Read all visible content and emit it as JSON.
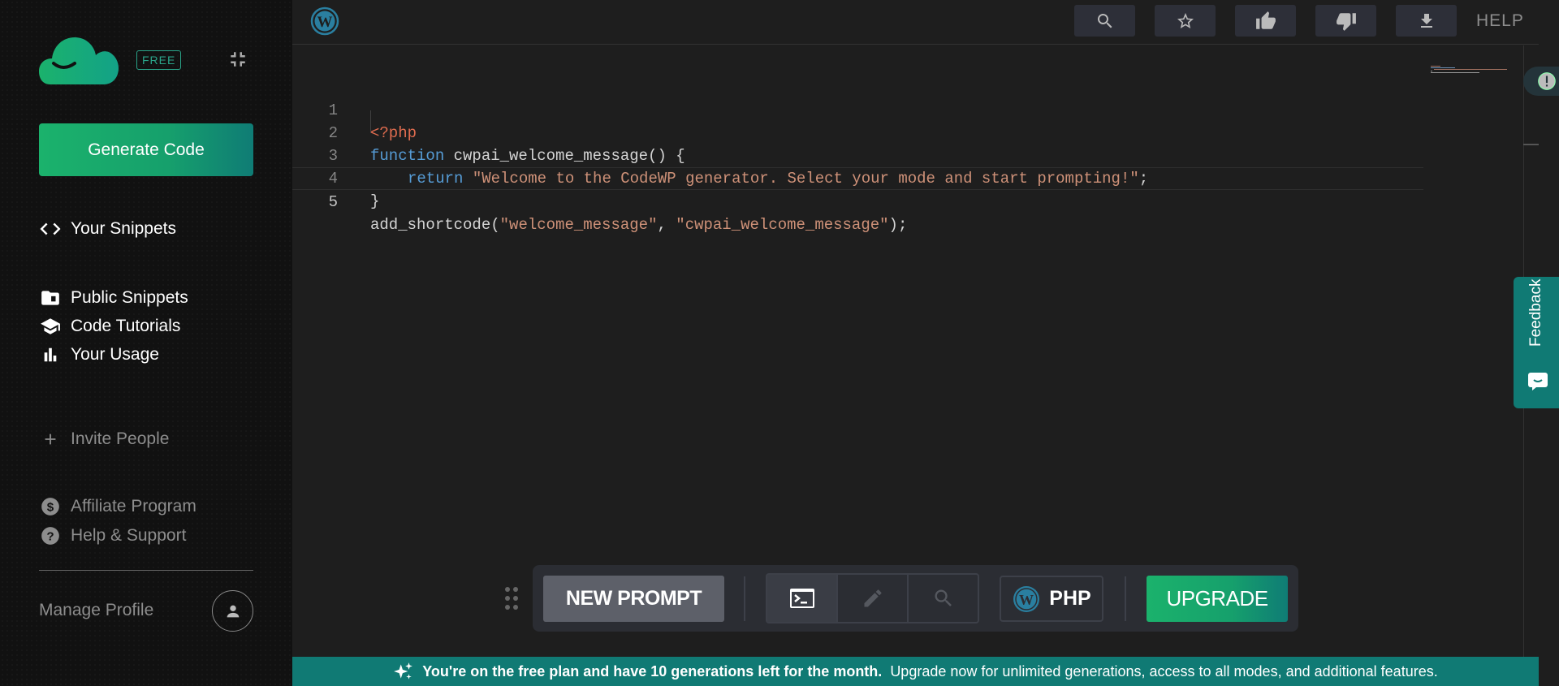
{
  "sidebar": {
    "badge": "FREE",
    "generate_label": "Generate Code",
    "items": [
      {
        "label": "Your Snippets",
        "icon": "code-icon"
      },
      {
        "label": "Public Snippets",
        "icon": "folder-icon"
      },
      {
        "label": "Code Tutorials",
        "icon": "graduation-cap-icon"
      },
      {
        "label": "Your Usage",
        "icon": "bar-chart-icon"
      },
      {
        "label": "Invite People",
        "icon": "plus-icon"
      },
      {
        "label": "Affiliate Program",
        "icon": "dollar-circle-icon"
      },
      {
        "label": "Help & Support",
        "icon": "help-circle-icon"
      }
    ],
    "manage_profile": "Manage Profile"
  },
  "topbar": {
    "buttons": [
      "search-icon",
      "star-icon",
      "thumbs-up-icon",
      "thumbs-down-icon",
      "download-icon"
    ],
    "help_label": "HELP"
  },
  "editor": {
    "line_numbers": [
      "1",
      "2",
      "3",
      "4",
      "5"
    ],
    "active_line": 5,
    "lines": {
      "l1": {
        "tag": "<?php"
      },
      "l2": {
        "kw": "function",
        "rest": " cwpai_welcome_message() {"
      },
      "l3": {
        "kw": "return",
        "str": "\"Welcome to the CodeWP generator. Select your mode and start prompting!\"",
        "end": ";"
      },
      "l4": {
        "text": "}"
      },
      "l5": {
        "fn": "add_shortcode(",
        "s1": "\"welcome_message\"",
        "comma": ", ",
        "s2": "\"cwpai_welcome_message\"",
        "end": ");"
      }
    }
  },
  "toolbar": {
    "new_prompt": "NEW PROMPT",
    "modes": [
      "terminal-icon",
      "pencil-icon",
      "search-icon"
    ],
    "language": "PHP",
    "upgrade": "UPGRADE"
  },
  "banner": {
    "bold": "You're on the free plan and have 10 generations left for the month.",
    "text": "Upgrade now for unlimited generations, access to all modes, and additional features."
  },
  "feedback": {
    "label": "Feedback"
  },
  "colors": {
    "accent_green": "#1bb26c",
    "accent_teal": "#107a74",
    "editor_bg": "#1e1e1e",
    "sidebar_bg": "#111111"
  }
}
